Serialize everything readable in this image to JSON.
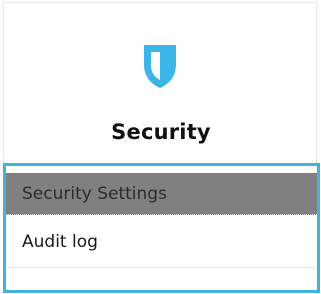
{
  "header": {
    "title": "Security",
    "icon": "shield-icon"
  },
  "menu": {
    "items": [
      {
        "label": "Security Settings",
        "selected": true
      },
      {
        "label": "Audit log",
        "selected": false
      }
    ]
  },
  "colors": {
    "accent": "#43b2db",
    "selected_bg": "#808080"
  }
}
